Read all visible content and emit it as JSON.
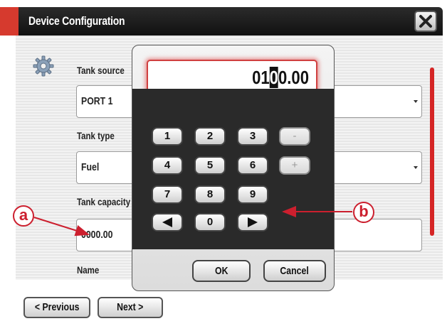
{
  "window": {
    "title": "Device Configuration"
  },
  "fields": [
    {
      "label": "Tank source",
      "value": "PORT 1"
    },
    {
      "label": "Tank type",
      "value": "Fuel"
    },
    {
      "label": "Tank capacity",
      "value": "0000.00"
    },
    {
      "label": "Name"
    }
  ],
  "nav": {
    "previous": "< Previous",
    "next": "Next >"
  },
  "dialog": {
    "entry_before": "01",
    "entry_cursor": "0",
    "entry_after": "0.00",
    "keys": [
      "1",
      "2",
      "3",
      "-",
      "4",
      "5",
      "6",
      "+",
      "7",
      "8",
      "9",
      "0"
    ],
    "ok": "OK",
    "cancel": "Cancel"
  },
  "annotations": {
    "a": "a",
    "b": "b"
  },
  "colors": {
    "accent": "#d63a2e",
    "annotation": "#cc1f2e",
    "keypad_bg": "#2a2a2a"
  },
  "icons": {
    "settings": "gear-icon",
    "close": "close-icon",
    "left": "arrow-left-icon",
    "right": "arrow-right-icon"
  }
}
